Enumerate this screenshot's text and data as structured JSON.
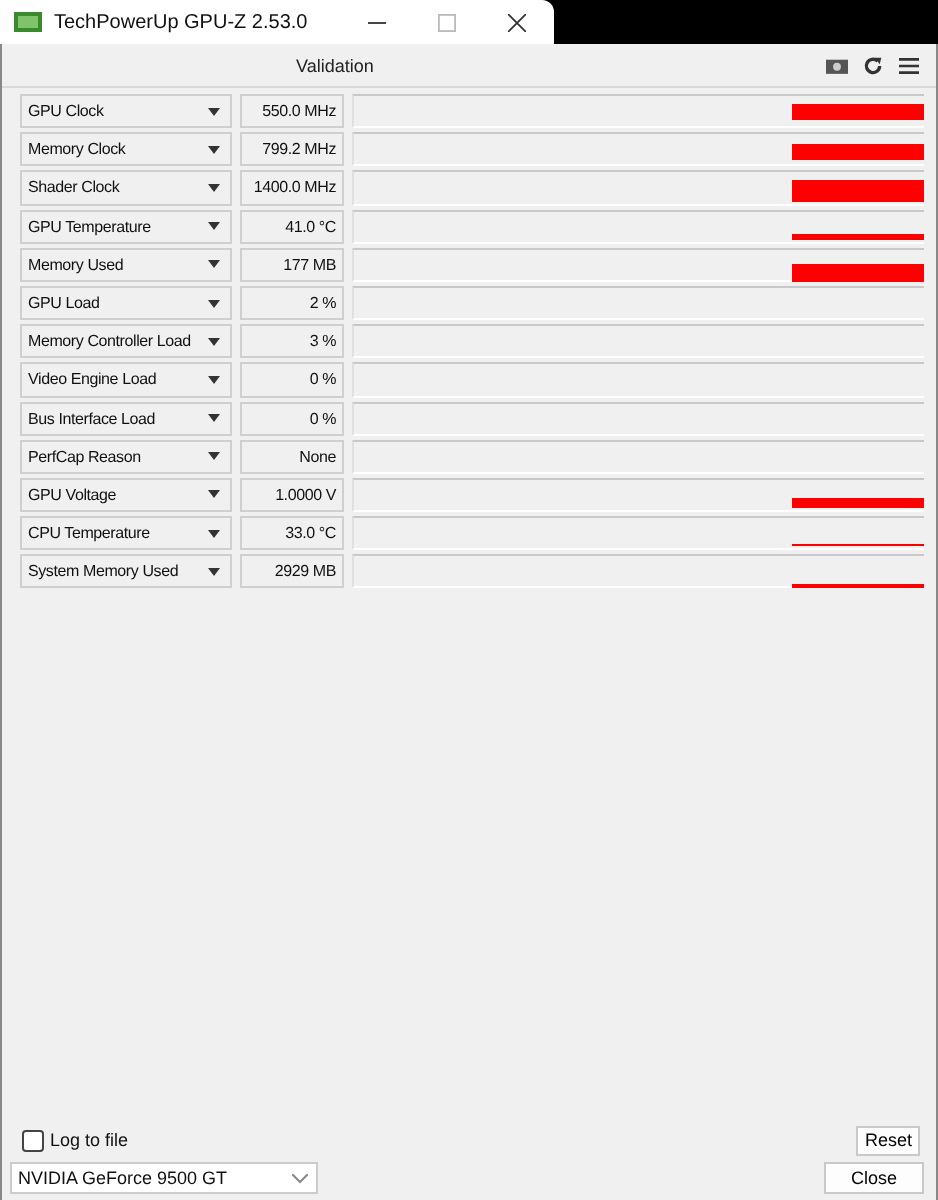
{
  "window": {
    "title": "TechPowerUp GPU-Z 2.53.0"
  },
  "tabs": [
    {
      "label": "Validation",
      "selected": false
    }
  ],
  "sensors": [
    {
      "name": "GPU Clock",
      "value": "550.0 MHz"
    },
    {
      "name": "Memory Clock",
      "value": "799.2 MHz"
    },
    {
      "name": "Shader Clock",
      "value": "1400.0 MHz"
    },
    {
      "name": "GPU Temperature",
      "value": "41.0 °C"
    },
    {
      "name": "Memory Used",
      "value": "177 MB"
    },
    {
      "name": "GPU Load",
      "value": "2 %"
    },
    {
      "name": "Memory Controller Load",
      "value": "3 %"
    },
    {
      "name": "Video Engine Load",
      "value": "0 %"
    },
    {
      "name": "Bus Interface Load",
      "value": "0 %"
    },
    {
      "name": "PerfCap Reason",
      "value": "None"
    },
    {
      "name": "GPU Voltage",
      "value": "1.0000 V"
    },
    {
      "name": "CPU Temperature",
      "value": "33.0 °C"
    },
    {
      "name": "System Memory Used",
      "value": "2929 MB"
    }
  ],
  "log_to_file": {
    "label": "Log to file",
    "checked": false
  },
  "reset_button": "Reset",
  "device": "NVIDIA GeForce 9500 GT",
  "close_button": "Close"
}
